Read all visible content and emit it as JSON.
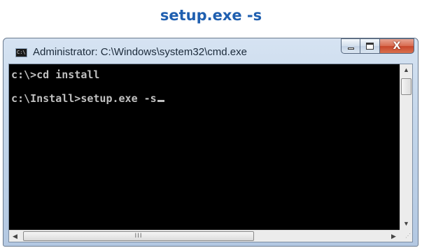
{
  "page": {
    "heading": "setup.exe -s"
  },
  "window": {
    "title": "Administrator: C:\\Windows\\system32\\cmd.exe",
    "icon": "cmd-icon",
    "icon_text": "C:\\",
    "buttons": {
      "minimize": "minimize-icon",
      "maximize": "maximize-icon",
      "close": "close-icon",
      "close_glyph": "X"
    }
  },
  "console": {
    "lines": [
      "c:\\>cd install",
      "c:\\Install>setup.exe -s"
    ]
  },
  "scrollbars": {
    "vertical": {
      "up": "▲",
      "down": "▼"
    },
    "horizontal": {
      "left": "◀",
      "right": "▶",
      "grip": "III"
    },
    "size_grip": "⋰"
  },
  "colors": {
    "heading": "#1f5fb0",
    "console_bg": "#000000",
    "console_text": "#c0c0c0"
  }
}
